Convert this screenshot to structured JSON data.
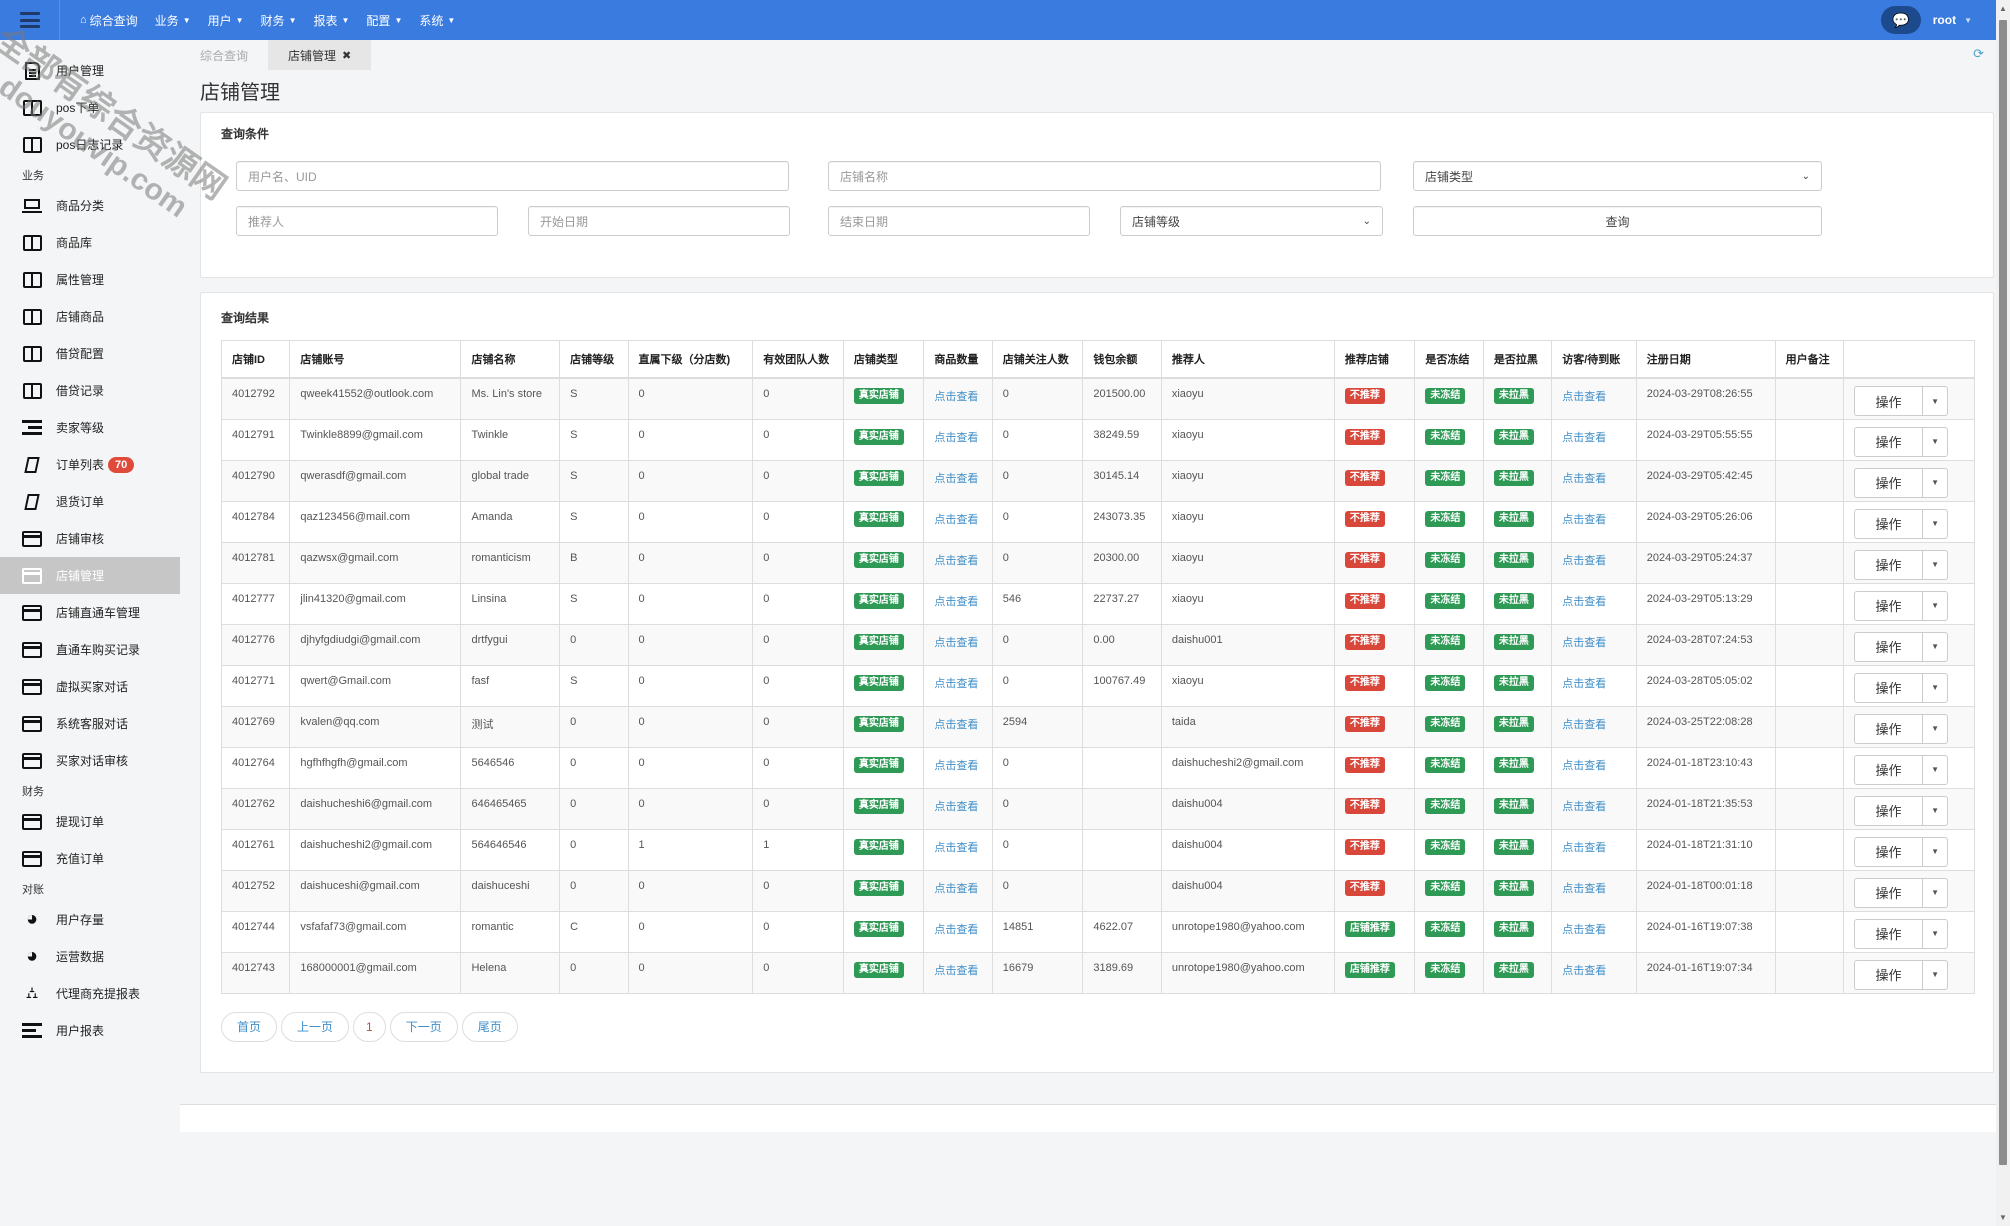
{
  "topbar": {
    "nav": [
      {
        "label": "综合查询",
        "icon": "home-icon",
        "dropdown": false
      },
      {
        "label": "业务",
        "dropdown": true
      },
      {
        "label": "用户",
        "dropdown": true
      },
      {
        "label": "财务",
        "dropdown": true
      },
      {
        "label": "报表",
        "dropdown": true
      },
      {
        "label": "配置",
        "dropdown": true
      },
      {
        "label": "系统",
        "dropdown": true
      }
    ],
    "user": "root"
  },
  "sidebar": {
    "groups": [
      {
        "section": "",
        "items": [
          {
            "label": "用户管理",
            "icon": "doc"
          },
          {
            "label": "pos下单",
            "icon": "book"
          },
          {
            "label": "pos日志记录",
            "icon": "book"
          }
        ]
      },
      {
        "section": "业务",
        "items": [
          {
            "label": "商品分类",
            "icon": "laptop"
          },
          {
            "label": "商品库",
            "icon": "book"
          },
          {
            "label": "属性管理",
            "icon": "book"
          },
          {
            "label": "店铺商品",
            "icon": "book"
          },
          {
            "label": "借贷配置",
            "icon": "book"
          },
          {
            "label": "借贷记录",
            "icon": "book"
          },
          {
            "label": "卖家等级",
            "icon": "indent"
          },
          {
            "label": "订单列表",
            "icon": "para",
            "badge": "70"
          },
          {
            "label": "退货订单",
            "icon": "para"
          },
          {
            "label": "店铺审核",
            "icon": "card"
          },
          {
            "label": "店铺管理",
            "icon": "card",
            "active": true
          },
          {
            "label": "店铺直通车管理",
            "icon": "card"
          },
          {
            "label": "直通车购买记录",
            "icon": "card"
          },
          {
            "label": "虚拟买家对话",
            "icon": "card"
          },
          {
            "label": "系统客服对话",
            "icon": "card"
          },
          {
            "label": "买家对话审核",
            "icon": "card"
          }
        ]
      },
      {
        "section": "财务",
        "items": [
          {
            "label": "提现订单",
            "icon": "card"
          },
          {
            "label": "充值订单",
            "icon": "card"
          }
        ]
      },
      {
        "section": "对账",
        "items": [
          {
            "label": "用户存量",
            "icon": "pie"
          },
          {
            "label": "运营数据",
            "icon": "pie"
          },
          {
            "label": "代理商充提报表",
            "icon": "sitemap"
          },
          {
            "label": "用户报表",
            "icon": "list"
          }
        ]
      }
    ]
  },
  "tabs": [
    {
      "label": "综合查询",
      "active": false
    },
    {
      "label": "店铺管理",
      "active": true
    }
  ],
  "page_title": "店铺管理",
  "filters": {
    "title": "查询条件",
    "username_placeholder": "用户名、UID",
    "shopname_placeholder": "店铺名称",
    "shoptype_selected": "店铺类型",
    "referrer_placeholder": "推荐人",
    "start_date_placeholder": "开始日期",
    "end_date_placeholder": "结束日期",
    "level_selected": "店铺等级",
    "search_label": "查询"
  },
  "results": {
    "title": "查询结果",
    "columns": [
      "店铺ID",
      "店铺账号",
      "店铺名称",
      "店铺等级",
      "直属下级（分店数)",
      "有效团队人数",
      "店铺类型",
      "商品数量",
      "店铺关注人数",
      "钱包余额",
      "推荐人",
      "推荐店铺",
      "是否冻结",
      "是否拉黑",
      "访客/待到账",
      "注册日期",
      "用户备注",
      ""
    ],
    "view_link": "点击查看",
    "op_label": "操作",
    "rows": [
      {
        "id": "4012792",
        "account": "qweek41552@outlook.com",
        "name": "Ms. Lin's store",
        "level": "S",
        "sub": "0",
        "team": "0",
        "type": "真实店铺",
        "follow": "0",
        "balance": "201500.00",
        "referrer": "xiaoyu",
        "recommend": "不推荐",
        "recommend_on": false,
        "frozen": "未冻结",
        "black": "未拉黑",
        "date": "2024-03-29T08:26:55",
        "note": ""
      },
      {
        "id": "4012791",
        "account": "Twinkle8899@gmail.com",
        "name": "Twinkle",
        "level": "S",
        "sub": "0",
        "team": "0",
        "type": "真实店铺",
        "follow": "0",
        "balance": "38249.59",
        "referrer": "xiaoyu",
        "recommend": "不推荐",
        "recommend_on": false,
        "frozen": "未冻结",
        "black": "未拉黑",
        "date": "2024-03-29T05:55:55",
        "note": ""
      },
      {
        "id": "4012790",
        "account": "qwerasdf@gmail.com",
        "name": "global trade",
        "level": "S",
        "sub": "0",
        "team": "0",
        "type": "真实店铺",
        "follow": "0",
        "balance": "30145.14",
        "referrer": "xiaoyu",
        "recommend": "不推荐",
        "recommend_on": false,
        "frozen": "未冻结",
        "black": "未拉黑",
        "date": "2024-03-29T05:42:45",
        "note": ""
      },
      {
        "id": "4012784",
        "account": "qaz123456@mail.com",
        "name": "Amanda",
        "level": "S",
        "sub": "0",
        "team": "0",
        "type": "真实店铺",
        "follow": "0",
        "balance": "243073.35",
        "referrer": "xiaoyu",
        "recommend": "不推荐",
        "recommend_on": false,
        "frozen": "未冻结",
        "black": "未拉黑",
        "date": "2024-03-29T05:26:06",
        "note": ""
      },
      {
        "id": "4012781",
        "account": "qazwsx@gmail.com",
        "name": "romanticism",
        "level": "B",
        "sub": "0",
        "team": "0",
        "type": "真实店铺",
        "follow": "0",
        "balance": "20300.00",
        "referrer": "xiaoyu",
        "recommend": "不推荐",
        "recommend_on": false,
        "frozen": "未冻结",
        "black": "未拉黑",
        "date": "2024-03-29T05:24:37",
        "note": ""
      },
      {
        "id": "4012777",
        "account": "jlin41320@gmail.com",
        "name": "Linsina",
        "level": "S",
        "sub": "0",
        "team": "0",
        "type": "真实店铺",
        "follow": "546",
        "balance": "22737.27",
        "referrer": "xiaoyu",
        "recommend": "不推荐",
        "recommend_on": false,
        "frozen": "未冻结",
        "black": "未拉黑",
        "date": "2024-03-29T05:13:29",
        "note": ""
      },
      {
        "id": "4012776",
        "account": "djhyfgdiudgi@gmail.com",
        "name": "drtfygui",
        "level": "0",
        "sub": "0",
        "team": "0",
        "type": "真实店铺",
        "follow": "0",
        "balance": "0.00",
        "referrer": "daishu001",
        "recommend": "不推荐",
        "recommend_on": false,
        "frozen": "未冻结",
        "black": "未拉黑",
        "date": "2024-03-28T07:24:53",
        "note": ""
      },
      {
        "id": "4012771",
        "account": "qwert@Gmail.com",
        "name": "fasf",
        "level": "S",
        "sub": "0",
        "team": "0",
        "type": "真实店铺",
        "follow": "0",
        "balance": "100767.49",
        "referrer": "xiaoyu",
        "recommend": "不推荐",
        "recommend_on": false,
        "frozen": "未冻结",
        "black": "未拉黑",
        "date": "2024-03-28T05:05:02",
        "note": ""
      },
      {
        "id": "4012769",
        "account": "kvalen@qq.com",
        "name": "测试",
        "level": "0",
        "sub": "0",
        "team": "0",
        "type": "真实店铺",
        "follow": "2594",
        "balance": "",
        "referrer": "taida",
        "recommend": "不推荐",
        "recommend_on": false,
        "frozen": "未冻结",
        "black": "未拉黑",
        "date": "2024-03-25T22:08:28",
        "note": ""
      },
      {
        "id": "4012764",
        "account": "hgfhfhgfh@gmail.com",
        "name": "5646546",
        "level": "0",
        "sub": "0",
        "team": "0",
        "type": "真实店铺",
        "follow": "0",
        "balance": "",
        "referrer": "daishucheshi2@gmail.com",
        "recommend": "不推荐",
        "recommend_on": false,
        "frozen": "未冻结",
        "black": "未拉黑",
        "date": "2024-01-18T23:10:43",
        "note": ""
      },
      {
        "id": "4012762",
        "account": "daishucheshi6@gmail.com",
        "name": "646465465",
        "level": "0",
        "sub": "0",
        "team": "0",
        "type": "真实店铺",
        "follow": "0",
        "balance": "",
        "referrer": "daishu004",
        "recommend": "不推荐",
        "recommend_on": false,
        "frozen": "未冻结",
        "black": "未拉黑",
        "date": "2024-01-18T21:35:53",
        "note": ""
      },
      {
        "id": "4012761",
        "account": "daishucheshi2@gmail.com",
        "name": "564646546",
        "level": "0",
        "sub": "1",
        "team": "1",
        "type": "真实店铺",
        "follow": "0",
        "balance": "",
        "referrer": "daishu004",
        "recommend": "不推荐",
        "recommend_on": false,
        "frozen": "未冻结",
        "black": "未拉黑",
        "date": "2024-01-18T21:31:10",
        "note": ""
      },
      {
        "id": "4012752",
        "account": "daishuceshi@gmail.com",
        "name": "daishuceshi",
        "level": "0",
        "sub": "0",
        "team": "0",
        "type": "真实店铺",
        "follow": "0",
        "balance": "",
        "referrer": "daishu004",
        "recommend": "不推荐",
        "recommend_on": false,
        "frozen": "未冻结",
        "black": "未拉黑",
        "date": "2024-01-18T00:01:18",
        "note": ""
      },
      {
        "id": "4012744",
        "account": "vsfafaf73@gmail.com",
        "name": "romantic",
        "level": "C",
        "sub": "0",
        "team": "0",
        "type": "真实店铺",
        "follow": "14851",
        "balance": "4622.07",
        "referrer": "unrotope1980@yahoo.com",
        "recommend": "店铺推荐",
        "recommend_on": true,
        "frozen": "未冻结",
        "black": "未拉黑",
        "date": "2024-01-16T19:07:38",
        "note": ""
      },
      {
        "id": "4012743",
        "account": "168000001@gmail.com",
        "name": "Helena",
        "level": "0",
        "sub": "0",
        "team": "0",
        "type": "真实店铺",
        "follow": "16679",
        "balance": "3189.69",
        "referrer": "unrotope1980@yahoo.com",
        "recommend": "店铺推荐",
        "recommend_on": true,
        "frozen": "未冻结",
        "black": "未拉黑",
        "date": "2024-01-16T19:07:34",
        "note": ""
      }
    ]
  },
  "pager": {
    "first": "首页",
    "prev": "上一页",
    "current": "1",
    "next": "下一页",
    "last": "尾页"
  },
  "colors": {
    "topbar": "#3a7be0",
    "label_green": "#2e9a56",
    "label_red": "#d9473b",
    "link": "#3f8ec8",
    "badge": "#e04a3a"
  },
  "watermark": {
    "line1": "全部有综合资源网",
    "line2": "douyouvip.com"
  }
}
